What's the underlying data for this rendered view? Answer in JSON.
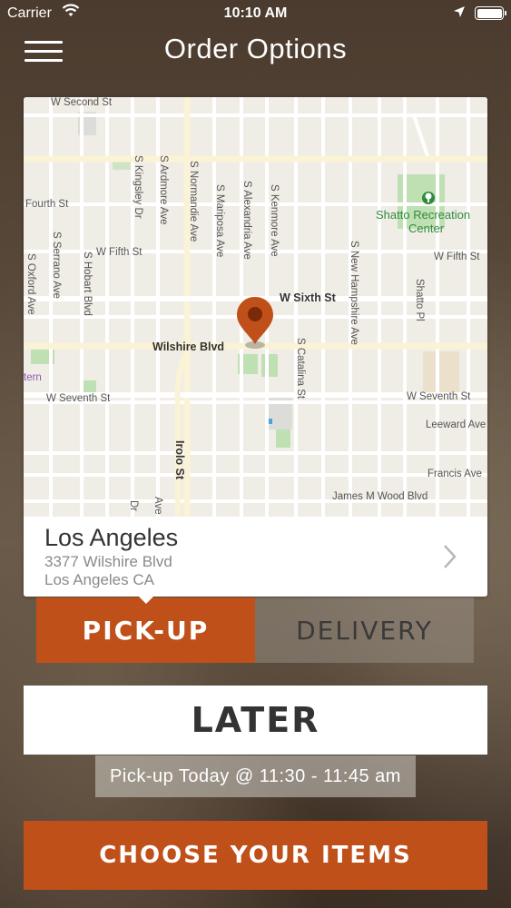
{
  "status_bar": {
    "carrier": "Carrier",
    "time": "10:10 AM",
    "battery_level": 1.0
  },
  "header": {
    "title": "Order Options",
    "menu_icon": "hamburger-icon"
  },
  "map": {
    "streets": {
      "w_second": "W Second St",
      "fourth": "Fourth St",
      "w_fifth": "W Fifth St",
      "w_fifth_right": "W Fifth St",
      "w_sixth": "W Sixth St",
      "wilshire": "Wilshire Blvd",
      "w_seventh": "W Seventh St",
      "w_seventh_right": "W Seventh St",
      "leeward": "Leeward Ave",
      "francis": "Francis Ave",
      "james_m_wood": "James M Wood Blvd",
      "s_kingsley": "S Kingsley Dr",
      "s_ardmore": "S Ardmore Ave",
      "s_normandie": "S Normandie Ave",
      "s_mariposa": "S Mariposa Ave",
      "s_alexandria": "S Alexandria Ave",
      "s_kenmore": "S Kenmore Ave",
      "s_serrano": "S Serrano Ave",
      "s_hobart": "S Hobart Blvd",
      "s_oxford": "S Oxford Ave",
      "s_catalina": "S Catalina St",
      "s_new_hampshire": "S New Hampshire Ave",
      "shatto_pl": "Shatto Pl",
      "irolo": "Irolo St",
      "dr_partial": "Dr",
      "ave_partial": "Ave",
      "tern_partial": "tern"
    },
    "poi": {
      "park_line1": "Shatto Recreation",
      "park_line2": "Center"
    },
    "pin_icon": "map-pin-icon"
  },
  "location": {
    "name": "Los Angeles",
    "address_line1": "3377 Wilshire Blvd",
    "address_line2": "Los Angeles CA",
    "chevron_icon": "chevron-right-icon"
  },
  "order_type": {
    "pickup_label": "PICK-UP",
    "delivery_label": "DELIVERY",
    "selected": "pickup",
    "colors": {
      "accent": "#c0501a"
    }
  },
  "timing": {
    "later_label": "LATER",
    "pickup_time_text": "Pick-up Today @ 11:30 - 11:45 am"
  },
  "cta": {
    "choose_label": "CHOOSE YOUR ITEMS"
  }
}
